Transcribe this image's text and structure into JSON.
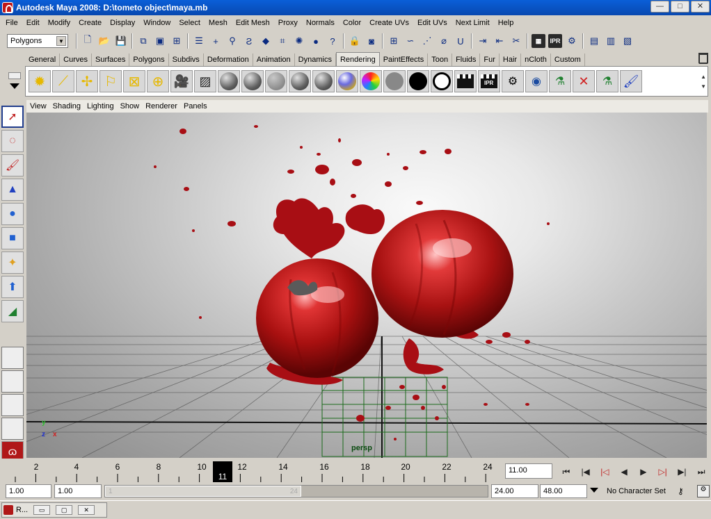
{
  "window": {
    "title": "Autodesk Maya 2008: D:\\tometo object\\maya.mb",
    "minimize": "—",
    "maximize": "□",
    "close": "✕"
  },
  "menu": [
    "File",
    "Edit",
    "Modify",
    "Create",
    "Display",
    "Window",
    "Select",
    "Mesh",
    "Edit Mesh",
    "Proxy",
    "Normals",
    "Color",
    "Create UVs",
    "Edit UVs",
    "Next Limit",
    "Help"
  ],
  "status_line": {
    "mode": "Polygons"
  },
  "shelf": {
    "tabs": [
      "General",
      "Curves",
      "Surfaces",
      "Polygons",
      "Subdivs",
      "Deformation",
      "Animation",
      "Dynamics",
      "Rendering",
      "PaintEffects",
      "Toon",
      "Fluids",
      "Fur",
      "Hair",
      "nCloth",
      "Custom"
    ],
    "active_tab": "Rendering"
  },
  "panel_menu": [
    "View",
    "Shading",
    "Lighting",
    "Show",
    "Renderer",
    "Panels"
  ],
  "viewport": {
    "camera": "persp",
    "axis": {
      "y": "y",
      "z": "z",
      "x": "x"
    }
  },
  "timeline": {
    "ticks": [
      "2",
      "4",
      "6",
      "8",
      "10",
      "12",
      "14",
      "16",
      "18",
      "20",
      "22",
      "24"
    ],
    "current_frame": "11",
    "current_time": "11.00"
  },
  "range": {
    "start_time": "1.00",
    "playback_start": "1.00",
    "handle_start": "1",
    "handle_end": "24",
    "playback_end": "24.00",
    "end_time": "48.00",
    "character_set": "No Character Set"
  },
  "taskbar": {
    "label": "R..."
  }
}
